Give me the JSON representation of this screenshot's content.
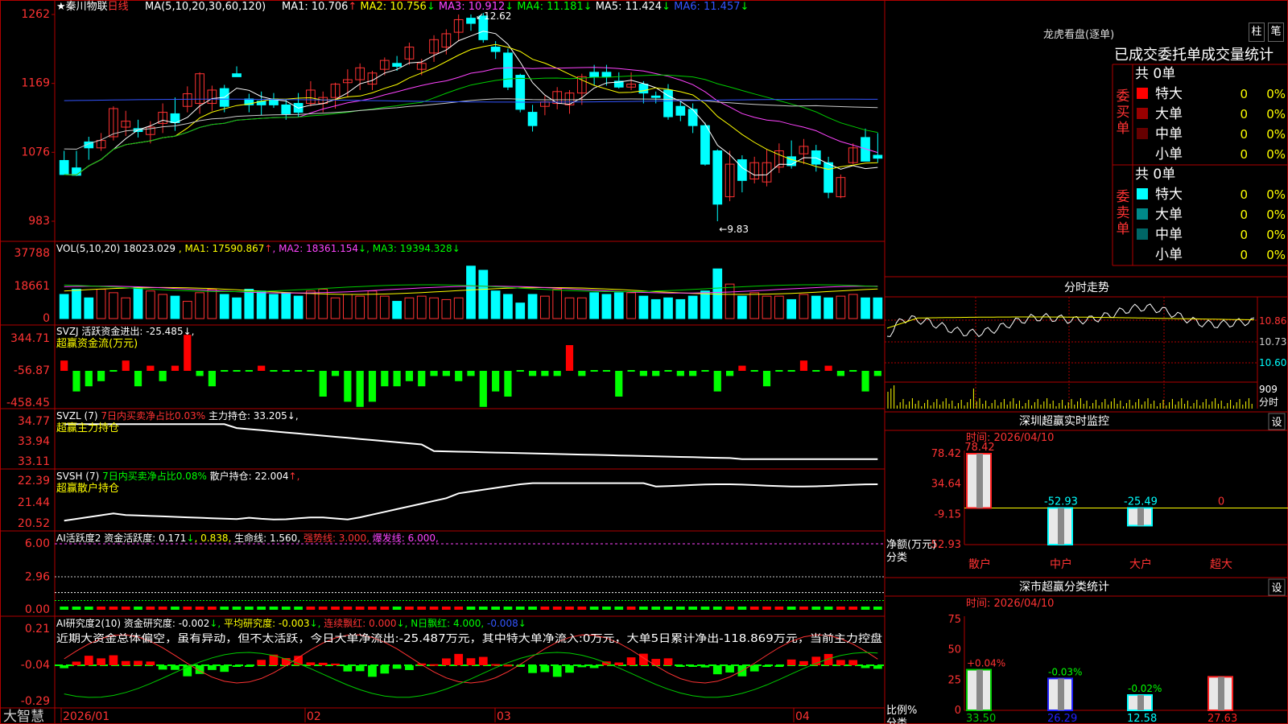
{
  "stock": {
    "star": "★",
    "name": "秦川物联",
    "period": "日线"
  },
  "price_panel": {
    "ma_label": "MA(5,10,20,30,60,120)",
    "ma_values": [
      {
        "label": "MA1:",
        "value": "10.706",
        "arrow": "↑",
        "color": "#ffffff",
        "arrow_color": "#ff3333"
      },
      {
        "label": "MA2:",
        "value": "10.756",
        "arrow": "↓",
        "color": "#ffff00",
        "arrow_color": "#00ff00"
      },
      {
        "label": "MA3:",
        "value": "10.912",
        "arrow": "↓",
        "color": "#ff44ff",
        "arrow_color": "#00ff00"
      },
      {
        "label": "MA4:",
        "value": "11.181",
        "arrow": "↓",
        "color": "#00ff00",
        "arrow_color": "#00ff00"
      },
      {
        "label": "MA5:",
        "value": "11.424",
        "arrow": "↓",
        "color": "#ffffff",
        "arrow_color": "#00ff00"
      },
      {
        "label": "MA6:",
        "value": "11.457",
        "arrow": "↓",
        "color": "#3355ff",
        "arrow_color": "#00ff00"
      }
    ],
    "y_ticks": [
      "1262",
      "1169",
      "1076",
      "983"
    ],
    "max_label": "12.62",
    "min_label": "9.83"
  },
  "vol_panel": {
    "label": "VOL(5,10,20)",
    "value": "18023.029",
    "ma_values": [
      {
        "label": "MA1:",
        "value": "17590.867",
        "arrow": "↑",
        "color": "#ffff00",
        "arrow_color": "#ff3333"
      },
      {
        "label": "MA2:",
        "value": "18361.154",
        "arrow": "↓",
        "color": "#ff44ff",
        "arrow_color": "#00ff00"
      },
      {
        "label": "MA3:",
        "value": "19394.328",
        "arrow": "↓",
        "color": "#00ff00",
        "arrow_color": "#00ff00"
      }
    ],
    "y_ticks": [
      "37788",
      "18661",
      "0"
    ]
  },
  "svzj_panel": {
    "label": "SVZJ",
    "item": "活跃资金进出:",
    "value": "-25.485",
    "arrow": "↓",
    "sub": "超赢资金流(万元)",
    "y_ticks": [
      "344.71",
      "-56.87",
      "-458.45"
    ]
  },
  "svzl_panel": {
    "label": "SVZL (7)",
    "item1": "7日内买卖净占比0.03%",
    "item2": "主力持仓:",
    "value": "33.205",
    "arrow": "↓",
    "sub": "超赢主力持仓",
    "y_ticks": [
      "34.77",
      "33.94",
      "33.11"
    ]
  },
  "svsh_panel": {
    "label": "SVSH (7)",
    "item1": "7日内买卖净占比0.08%",
    "item2": "散户持仓:",
    "value": "22.004",
    "arrow": "↑",
    "sub": "超赢散户持仓",
    "y_ticks": [
      "22.39",
      "21.44",
      "20.52"
    ]
  },
  "ai_active_panel": {
    "label": "AI活跃度2",
    "item": "资金活跃度:",
    "v1": "0.171",
    "v2": "0.838",
    "item2": "生命线:",
    "v3": "1.560",
    "item3": "强势线:",
    "v4": "3.000",
    "item4": "爆发线:",
    "v5": "6.000",
    "y_ticks": [
      "6.00",
      "2.96",
      "0.00"
    ]
  },
  "ai_research_panel": {
    "label": "AI研究度2(10)",
    "item": "资金研究度:",
    "v1": "-0.002",
    "item2": "平均研究度:",
    "v2": "-0.003",
    "item3": "连续飘红:",
    "v3": "0.000",
    "item4": "N日飘红:",
    "v4": "4.000",
    "v5": "-0.008",
    "note": "近期大资金总体偏空，虽有异动，但不太活跃，今日大单净流出:-25.487万元，其中特大单净流入:0万元，大单5日累计净出-118.869万元，当前主力控盘",
    "y_ticks": [
      "0.21",
      "-0.04",
      "-0.29"
    ]
  },
  "x_axis": {
    "labels": [
      "2026/01",
      "02",
      "03",
      "04"
    ]
  },
  "footer": {
    "brand": "大智慧"
  },
  "dragon_tiger": {
    "title": "龙虎看盘(逐单)",
    "btn1": "柱",
    "btn2": "笔",
    "subtitle": "已成交委托单成交量统计",
    "buy_label": "委买单",
    "sell_label": "委卖单",
    "buy_total": "共 0单",
    "sell_total": "共 0单",
    "buy_rows": [
      {
        "name": "特大",
        "count": "0",
        "pct": "0%",
        "color": "#ff0000"
      },
      {
        "name": "大单",
        "count": "0",
        "pct": "0%",
        "color": "#990000"
      },
      {
        "name": "中单",
        "count": "0",
        "pct": "0%",
        "color": "#660000"
      },
      {
        "name": "小单",
        "count": "0",
        "pct": "0%",
        "color": "#000000"
      }
    ],
    "sell_rows": [
      {
        "name": "特大",
        "count": "0",
        "pct": "0%",
        "color": "#00ffff"
      },
      {
        "name": "大单",
        "count": "0",
        "pct": "0%",
        "color": "#008888"
      },
      {
        "name": "中单",
        "count": "0",
        "pct": "0%",
        "color": "#006666"
      },
      {
        "name": "小单",
        "count": "0",
        "pct": "0%",
        "color": "#000000"
      }
    ]
  },
  "intraday": {
    "title": "分时走势",
    "ticks": [
      "10.86",
      "10.73",
      "10.60"
    ],
    "vol_tick": "909",
    "vol_unit": "分时"
  },
  "shenzhen_monitor": {
    "title": "深圳超赢实时监控",
    "btn": "设",
    "time": "时间: 2026/04/10",
    "y_ticks": [
      "78.42",
      "34.64",
      "-9.15",
      "-52.93"
    ],
    "categories": [
      "散户",
      "中户",
      "大户",
      "超大"
    ],
    "values": [
      78.42,
      -52.93,
      -25.49,
      0
    ],
    "value_labels": [
      "78.42",
      "-52.93",
      "-25.49",
      "0"
    ],
    "ylabel": "净额(万元)",
    "xlabel": "分类"
  },
  "shenzhen_class": {
    "title": "深市超赢分类统计",
    "btn": "设",
    "time": "时间: 2026/04/10",
    "y_ticks": [
      "75",
      "50",
      "25",
      "0"
    ],
    "categories": [
      "散户",
      "中户",
      "大户",
      "超大"
    ],
    "values": [
      33.5,
      26.29,
      12.58,
      27.63
    ],
    "value_labels": [
      "33.50",
      "26.29",
      "12.58",
      "27.63"
    ],
    "change_labels": [
      "+0.04%",
      "-0.03%",
      "-0.02%",
      ""
    ],
    "ylabel": "比例%",
    "xlabel": "分类"
  },
  "chart_data": {
    "type": "candlestick",
    "candles_ohlc": [
      [
        10.65,
        10.78,
        10.48,
        10.46
      ],
      [
        10.55,
        10.78,
        10.44,
        10.45
      ],
      [
        10.9,
        10.97,
        10.66,
        10.82
      ],
      [
        10.82,
        11.02,
        10.78,
        10.92
      ],
      [
        10.97,
        11.38,
        10.92,
        11.35
      ],
      [
        11.1,
        11.32,
        10.98,
        11.18
      ],
      [
        11.08,
        11.2,
        10.96,
        11.04
      ],
      [
        11.0,
        11.18,
        10.88,
        11.1
      ],
      [
        11.15,
        11.42,
        11.02,
        11.3
      ],
      [
        11.28,
        11.5,
        11.05,
        11.16
      ],
      [
        11.38,
        11.65,
        11.3,
        11.55
      ],
      [
        11.42,
        11.84,
        11.28,
        11.82
      ],
      [
        11.42,
        11.66,
        11.32,
        11.6
      ],
      [
        11.62,
        11.67,
        11.3,
        11.38
      ],
      [
        11.82,
        11.92,
        11.78,
        11.78
      ],
      [
        11.48,
        11.55,
        11.3,
        11.4
      ],
      [
        11.45,
        11.58,
        11.26,
        11.4
      ],
      [
        11.48,
        11.56,
        11.36,
        11.4
      ],
      [
        11.4,
        11.48,
        11.2,
        11.28
      ],
      [
        11.42,
        11.56,
        11.24,
        11.3
      ],
      [
        11.42,
        11.72,
        11.38,
        11.6
      ],
      [
        11.42,
        11.58,
        11.3,
        11.5
      ],
      [
        11.5,
        11.7,
        11.35,
        11.68
      ],
      [
        11.7,
        11.88,
        11.5,
        11.74
      ],
      [
        11.74,
        11.96,
        11.6,
        11.9
      ],
      [
        11.68,
        11.86,
        11.6,
        11.83
      ],
      [
        11.88,
        12.04,
        11.8,
        12.0
      ],
      [
        11.96,
        12.06,
        11.86,
        11.92
      ],
      [
        12.02,
        12.24,
        11.94,
        12.18
      ],
      [
        11.88,
        12.02,
        11.8,
        11.96
      ],
      [
        12.1,
        12.34,
        11.98,
        12.28
      ],
      [
        12.18,
        12.42,
        12.08,
        12.36
      ],
      [
        12.38,
        12.62,
        12.26,
        12.55
      ],
      [
        12.57,
        12.62,
        12.4,
        12.5
      ],
      [
        12.6,
        12.64,
        12.24,
        12.28
      ],
      [
        12.18,
        12.26,
        12.02,
        12.12
      ],
      [
        12.1,
        12.16,
        11.6,
        11.64
      ],
      [
        11.8,
        11.82,
        11.3,
        11.34
      ],
      [
        11.3,
        11.4,
        11.04,
        11.12
      ],
      [
        11.38,
        11.52,
        11.26,
        11.44
      ],
      [
        11.42,
        11.64,
        11.34,
        11.58
      ],
      [
        11.4,
        11.6,
        11.28,
        11.56
      ],
      [
        11.56,
        11.82,
        11.4,
        11.78
      ],
      [
        11.84,
        11.94,
        11.66,
        11.78
      ],
      [
        11.84,
        11.94,
        11.66,
        11.78
      ],
      [
        11.72,
        11.84,
        11.62,
        11.64
      ],
      [
        11.64,
        11.84,
        11.6,
        11.68
      ],
      [
        11.68,
        11.72,
        11.42,
        11.56
      ],
      [
        11.52,
        11.58,
        11.42,
        11.5
      ],
      [
        11.6,
        11.68,
        11.2,
        11.24
      ],
      [
        11.38,
        11.45,
        11.18,
        11.26
      ],
      [
        11.34,
        11.42,
        11.02,
        11.12
      ],
      [
        11.12,
        11.16,
        10.58,
        10.6
      ],
      [
        10.78,
        10.8,
        9.83,
        10.06
      ],
      [
        10.16,
        10.78,
        10.1,
        10.6
      ],
      [
        10.66,
        10.72,
        10.22,
        10.38
      ],
      [
        10.4,
        10.7,
        10.34,
        10.62
      ],
      [
        10.36,
        10.8,
        10.3,
        10.62
      ],
      [
        10.56,
        10.88,
        10.48,
        10.78
      ],
      [
        10.7,
        10.92,
        10.54,
        10.58
      ],
      [
        10.74,
        10.94,
        10.6,
        10.84
      ],
      [
        10.78,
        10.86,
        10.5,
        10.6
      ],
      [
        10.62,
        10.7,
        10.14,
        10.22
      ],
      [
        10.16,
        10.46,
        10.14,
        10.42
      ],
      [
        10.62,
        10.88,
        10.6,
        10.82
      ],
      [
        10.96,
        11.08,
        10.64,
        10.64
      ],
      [
        10.72,
        11.02,
        10.62,
        10.68
      ]
    ],
    "ylim": [
      9.83,
      12.62
    ],
    "x_labels": [
      "2026/01",
      "02",
      "03",
      "04"
    ]
  }
}
